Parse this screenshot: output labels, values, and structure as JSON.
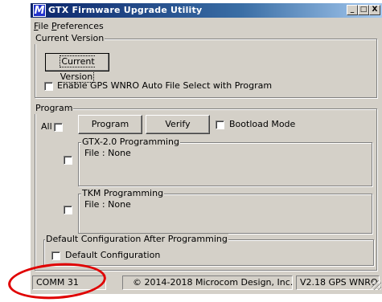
{
  "window": {
    "title": "GTX Firmware Upgrade Utility",
    "controls": {
      "minimize": "_",
      "maximize": "□",
      "close": "X"
    }
  },
  "menu": [
    {
      "accel": "F",
      "rest": "ile"
    },
    {
      "accel": "P",
      "rest": "references"
    }
  ],
  "current_version": {
    "group_label": "Current Version",
    "button_label": "Current Version",
    "enable_gps_label": "Enable GPS WNRO Auto File Select with Program",
    "enable_gps_checked": false
  },
  "program": {
    "group_label": "Program",
    "all_label": "All",
    "program_button": "Program",
    "verify_button": "Verify",
    "bootload_label": "Bootload Mode",
    "gtx_group": {
      "label": "GTX-2.0 Programming",
      "file_text": "File : None"
    },
    "tkm_group": {
      "label": "TKM Programming",
      "file_text": "File : None"
    },
    "default_config_group_label": "Default Configuration After Programming",
    "default_config_label": "Default Configuration"
  },
  "statusbar": {
    "comm": "COMM 31",
    "copyright": "© 2014-2018 Microcom Design, Inc.",
    "version": "V2.18 GPS WNRO"
  },
  "colors": {
    "title_gradient_start": "#0a246a",
    "window_face": "#d4d0c8",
    "annotation": "#e00000"
  }
}
